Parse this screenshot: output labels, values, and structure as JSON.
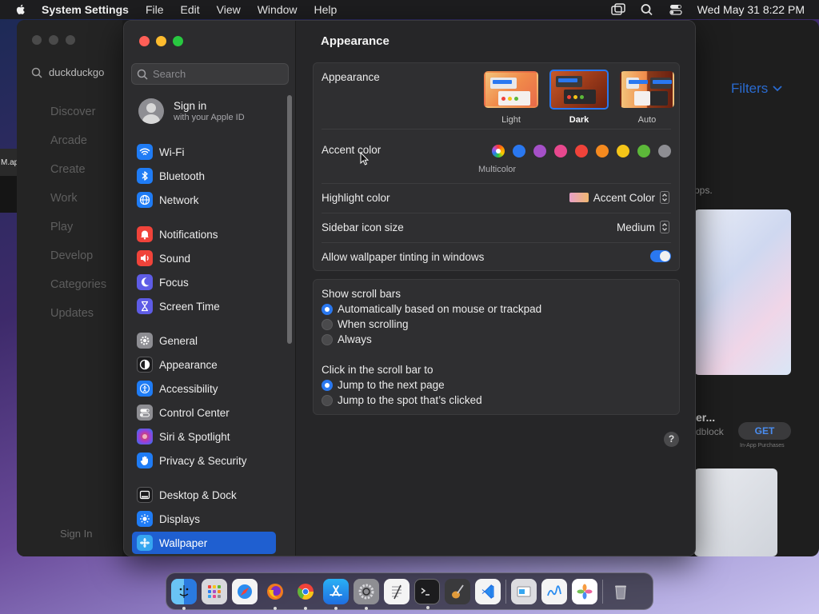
{
  "menubar": {
    "app_name": "System Settings",
    "items": [
      "File",
      "Edit",
      "View",
      "Window",
      "Help"
    ],
    "clock": "Wed May 31  8:22 PM"
  },
  "background_app": {
    "search_text": "duckduckgo",
    "nav": [
      "Discover",
      "Arcade",
      "Create",
      "Work",
      "Play",
      "Develop",
      "Categories",
      "Updates"
    ],
    "sign_in": "Sign In",
    "filters": "Filters",
    "apps_text": "pps.",
    "card_title": "er...",
    "card_sub": "dblock",
    "get_label": "GET",
    "purchases": "In-App Purchases",
    "left_tab": "M.ap"
  },
  "sidebar": {
    "search_placeholder": "Search",
    "account": {
      "title": "Sign in",
      "subtitle": "with your Apple ID"
    },
    "items": [
      {
        "label": "Wi-Fi",
        "icon": "wifi-icon",
        "color": "#1f7cf5"
      },
      {
        "label": "Bluetooth",
        "icon": "bluetooth-icon",
        "color": "#1f7cf5"
      },
      {
        "label": "Network",
        "icon": "globe-icon",
        "color": "#1f7cf5"
      },
      {
        "label": "Notifications",
        "icon": "bell-icon",
        "color": "#f0433a"
      },
      {
        "label": "Sound",
        "icon": "speaker-icon",
        "color": "#f0433a"
      },
      {
        "label": "Focus",
        "icon": "moon-icon",
        "color": "#5e5ce6"
      },
      {
        "label": "Screen Time",
        "icon": "hourglass-icon",
        "color": "#5e5ce6"
      },
      {
        "label": "General",
        "icon": "gear-icon",
        "color": "#8e8e93"
      },
      {
        "label": "Appearance",
        "icon": "appearance-icon",
        "color": "#1c1c1e"
      },
      {
        "label": "Accessibility",
        "icon": "accessibility-icon",
        "color": "#1f7cf5"
      },
      {
        "label": "Control Center",
        "icon": "switches-icon",
        "color": "#8e8e93"
      },
      {
        "label": "Siri & Spotlight",
        "icon": "siri-icon",
        "color": "#9b3fd8"
      },
      {
        "label": "Privacy & Security",
        "icon": "hand-icon",
        "color": "#1f7cf5"
      },
      {
        "label": "Desktop & Dock",
        "icon": "dock-icon",
        "color": "#1c1c1e"
      },
      {
        "label": "Displays",
        "icon": "sun-icon",
        "color": "#1f7cf5"
      },
      {
        "label": "Wallpaper",
        "icon": "flower-icon",
        "color": "#36a6f0"
      }
    ],
    "selected": "Wallpaper"
  },
  "content": {
    "title": "Appearance",
    "appearance_label": "Appearance",
    "modes": [
      {
        "label": "Light",
        "selected": false
      },
      {
        "label": "Dark",
        "selected": true
      },
      {
        "label": "Auto",
        "selected": false
      }
    ],
    "accent_label": "Accent color",
    "accent_colors": [
      "#2a78f0",
      "#a550c8",
      "#e8488e",
      "#f0433a",
      "#f58a1f",
      "#f5c518",
      "#5cb839",
      "#8e8e93"
    ],
    "accent_selected": "Multicolor",
    "highlight_label": "Highlight color",
    "highlight_value": "Accent Color",
    "sidebar_icon_label": "Sidebar icon size",
    "sidebar_icon_value": "Medium",
    "tinting_label": "Allow wallpaper tinting in windows",
    "tinting_on": true,
    "scrollbars_label": "Show scroll bars",
    "scrollbars_options": [
      {
        "label": "Automatically based on mouse or trackpad",
        "on": true
      },
      {
        "label": "When scrolling",
        "on": false
      },
      {
        "label": "Always",
        "on": false
      }
    ],
    "click_label": "Click in the scroll bar to",
    "click_options": [
      {
        "label": "Jump to the next page",
        "on": true
      },
      {
        "label": "Jump to the spot that’s clicked",
        "on": false
      }
    ],
    "help": "?"
  },
  "dock": {
    "apps": [
      {
        "name": "finder-icon",
        "color": "#2a8cf0",
        "running": true
      },
      {
        "name": "launchpad-icon",
        "color": "#c8c8cc",
        "running": false
      },
      {
        "name": "safari-icon",
        "color": "#2a8cf0",
        "running": false
      },
      {
        "name": "firefox-icon",
        "color": "#f07a1f",
        "running": true
      },
      {
        "name": "chrome-icon",
        "color": "#ffffff",
        "running": true
      },
      {
        "name": "app-store-icon",
        "color": "#2a8cf0",
        "running": true
      },
      {
        "name": "system-settings-icon",
        "color": "#8e8e93",
        "running": true
      },
      {
        "name": "textedit-icon",
        "color": "#f4f4f4",
        "running": false
      },
      {
        "name": "terminal-icon",
        "color": "#1c1c1e",
        "running": true
      },
      {
        "name": "garageband-icon",
        "color": "#3a3a3c",
        "running": false
      },
      {
        "name": "vscode-icon",
        "color": "#2a8cf0",
        "running": false
      },
      {
        "name": "preview-icon",
        "color": "#dcdce0",
        "running": false
      },
      {
        "name": "freeform-icon",
        "color": "#f4f4f4",
        "running": false
      },
      {
        "name": "photos-icon",
        "color": "#ffffff",
        "running": false
      },
      {
        "name": "trash-icon",
        "color": "#b8b8bc",
        "running": false
      }
    ]
  }
}
